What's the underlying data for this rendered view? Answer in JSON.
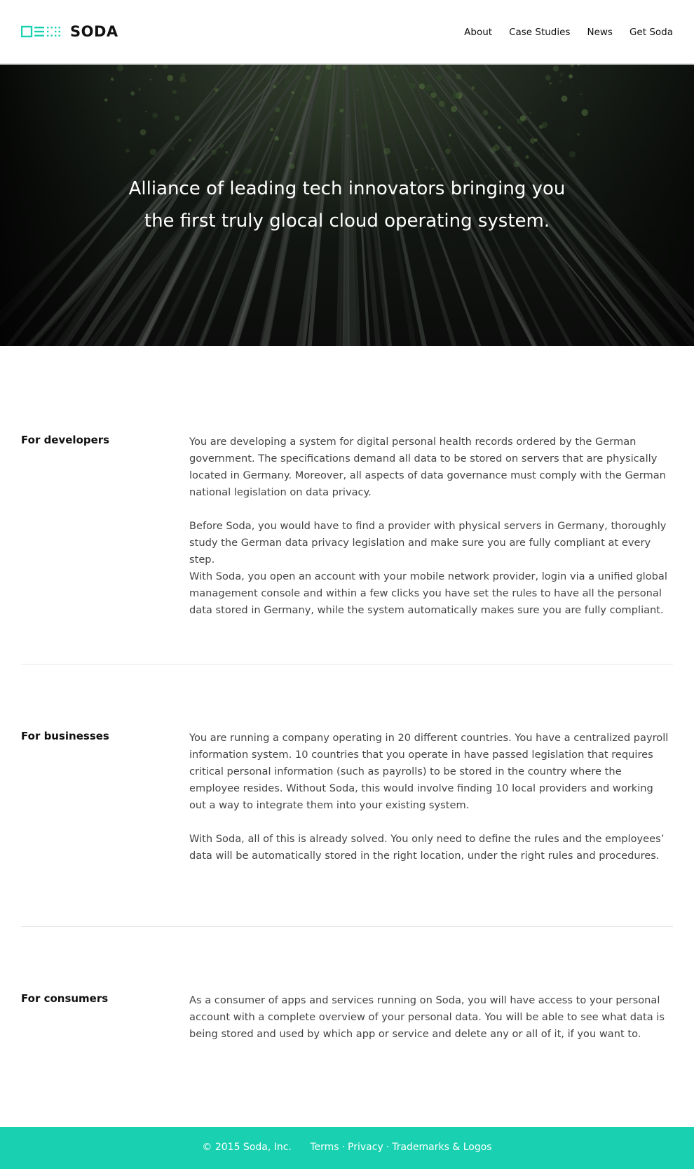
{
  "brand": {
    "name": "SODA",
    "accent_color": "#19d1b0",
    "logo_icon": "soda-logo-mark-icon"
  },
  "nav": {
    "items": [
      {
        "label": "About"
      },
      {
        "label": "Case Studies"
      },
      {
        "label": "News"
      },
      {
        "label": "Get Soda"
      }
    ]
  },
  "hero": {
    "line1": "Alliance of leading tech innovators bringing you",
    "line2": "the first truly glocal cloud operating system."
  },
  "sections": [
    {
      "title": "For developers",
      "paragraphs": [
        "You are developing a system for digital personal health records ordered by the German government. The specifications demand all data to be stored on servers that are physically located in Germany. Moreover, all aspects of data governance must comply with the German national legislation on data privacy.",
        "Before Soda, you would have to find a provider with physical servers in Germany, thoroughly study the German data privacy legislation and make sure you are fully compliant at every step.",
        "With Soda, you open an account with your mobile network provider, login via a unified global management console and within a few clicks you have set the rules to have all the personal data stored in Germany, while the system automatically makes sure you are fully compliant."
      ]
    },
    {
      "title": "For businesses",
      "paragraphs": [
        "You are running a company operating in 20 different countries. You have a centralized payroll information system. 10 countries that you operate in have passed legislation that requires critical personal information (such as payrolls) to be stored in the country where the employee resides. Without Soda, this would involve finding 10 local providers and working out a way to integrate them into your existing system.",
        "With Soda, all of this is already solved. You only need to define the rules and the employees’ data will be automatically stored in the right location, under the right rules and procedures."
      ]
    },
    {
      "title": "For consumers",
      "paragraphs": [
        "As a consumer of apps and services running on Soda, you will have access to your personal account with a complete overview of your personal data. You will be able to see what data is being stored and used by which app or service and delete any or all of it, if you want to."
      ]
    }
  ],
  "footer": {
    "copyright": "© 2015 Soda, Inc.",
    "links": [
      {
        "label": "Terms"
      },
      {
        "label": "Privacy"
      },
      {
        "label": "Trademarks & Logos"
      }
    ],
    "separator": "·"
  }
}
